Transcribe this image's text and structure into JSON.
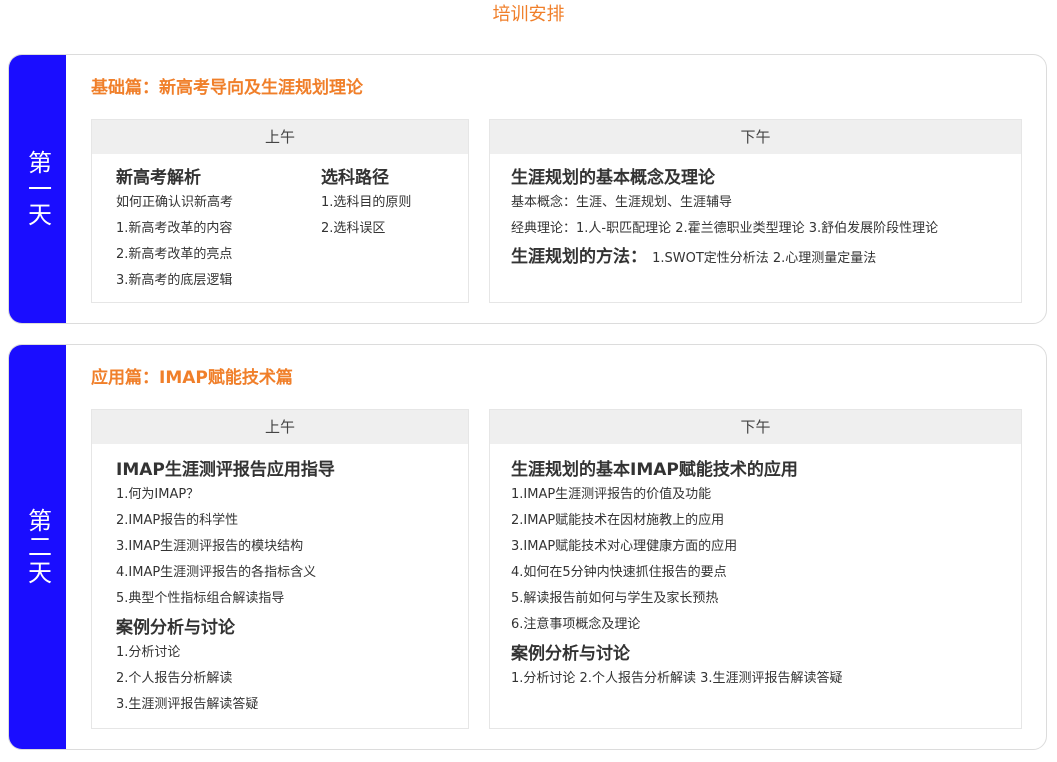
{
  "page_title": "培训安排",
  "colors": {
    "accent_orange": "#f07f2a",
    "day_tab_blue": "#1a0dff",
    "panel_header_bg": "#efefef"
  },
  "days": [
    {
      "label": "第一天",
      "title": "基础篇：新高考导向及生涯规划理论",
      "morning": {
        "header": "上午",
        "col1": {
          "heading": "新高考解析",
          "items": [
            "如何正确认识新高考",
            "1.新高考改革的内容",
            "2.新高考改革的亮点",
            "3.新高考的底层逻辑"
          ]
        },
        "col2": {
          "heading": "选科路径",
          "items": [
            "1.选科目的原则",
            "2.选科误区"
          ]
        }
      },
      "afternoon": {
        "header": "下午",
        "heading": "生涯规划的基本概念及理论",
        "items": [
          "基本概念：生涯、生涯规划、生涯辅导",
          "经典理论：1.人-职匹配理论  2.霍兰德职业类型理论  3.舒伯发展阶段性理论"
        ],
        "method_heading": "生涯规划的方法：",
        "method_text": "1.SWOT定性分析法  2.心理测量定量法"
      }
    },
    {
      "label": "第二天",
      "title": "应用篇：IMAP赋能技术篇",
      "morning": {
        "header": "上午",
        "heading": "IMAP生涯测评报告应用指导",
        "items": [
          "1.何为IMAP？",
          "2.IMAP报告的科学性",
          "3.IMAP生涯测评报告的模块结构",
          "4.IMAP生涯测评报告的各指标含义",
          "5.典型个性指标组合解读指导"
        ],
        "heading2": "案例分析与讨论",
        "items2": [
          "1.分析讨论",
          "2.个人报告分析解读",
          "3.生涯测评报告解读答疑"
        ]
      },
      "afternoon": {
        "header": "下午",
        "heading": "生涯规划的基本IMAP赋能技术的应用",
        "items": [
          "1.IMAP生涯测评报告的价值及功能",
          "2.IMAP赋能技术在因材施教上的应用",
          "3.IMAP赋能技术对心理健康方面的应用",
          "4.如何在5分钟内快速抓住报告的要点",
          "5.解读报告前如何与学生及家长预热",
          "6.注意事项概念及理论"
        ],
        "heading2": "案例分析与讨论",
        "items2_line": "1.分析讨论  2.个人报告分析解读  3.生涯测评报告解读答疑"
      }
    }
  ]
}
